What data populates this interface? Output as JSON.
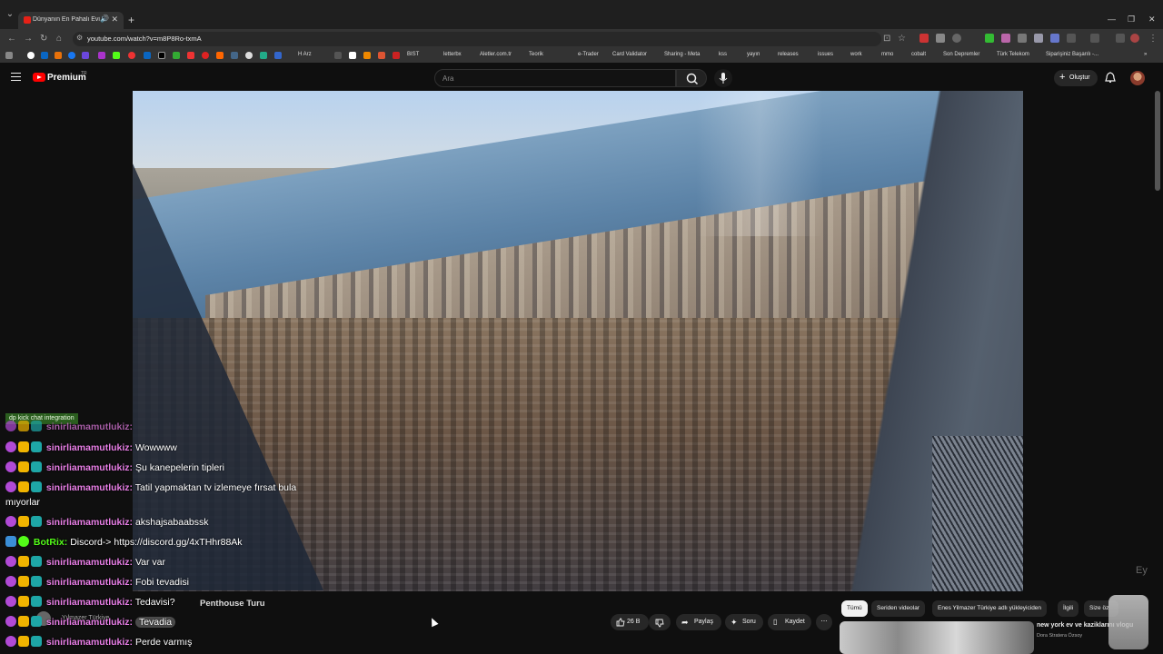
{
  "browser": {
    "tab_title": "Dünyanın En Pahalı Evi / N...",
    "url": "youtube.com/watch?v=m8P8Ro-txmA",
    "bookmarks": [
      "H Arz",
      "BIST",
      "letterbx",
      "Aletler.com.tr",
      "Teorik",
      "e-Trader",
      "Card Validator",
      "Sharing - Meta",
      "kss",
      "yayın",
      "releases",
      "issues",
      "work",
      "mmo",
      "cobalt",
      "Son Depremler",
      "Türk Telekom",
      "Siparişiniz Başarılı -..."
    ]
  },
  "masthead": {
    "logo_text": "Premium",
    "logo_sup": "TR",
    "search_placeholder": "Ara",
    "create_label": "Oluştur"
  },
  "chat": {
    "header": "dp kick chat integration",
    "messages": [
      {
        "user": "sinirliamamutlukiz:",
        "text": ""
      },
      {
        "user": "sinirliamamutlukiz:",
        "text": "Wowwww"
      },
      {
        "user": "sinirliamamutlukiz:",
        "text": "Şu kanepelerin tipleri"
      },
      {
        "user": "sinirliamamutlukiz:",
        "text": "Tatil yapmaktan tv izlemeye fırsat bula",
        "wrap": "mıyorlar"
      },
      {
        "user": "sinirliamamutlukiz:",
        "text": "akshajsabaabssk"
      },
      {
        "user": "BotRix:",
        "text": "Discord-> https://discord.gg/4xTHhr88Ak",
        "bot": true
      },
      {
        "user": "sinirliamamutlukiz:",
        "text": "Var var"
      },
      {
        "user": "sinirliamamutlukiz:",
        "text": "Fobi tevadisi"
      },
      {
        "user": "sinirliamamutlukiz:",
        "text": "Tedavisi?"
      },
      {
        "user": "sinirliamamutlukiz:",
        "text": "Tevadia"
      },
      {
        "user": "sinirliamamutlukiz:",
        "text": "Perde varmış"
      }
    ]
  },
  "video": {
    "title_fragment": "Penthouse Turu",
    "channel_fragment": "Yılmazer Türkiye"
  },
  "actions": {
    "likes": "26 B",
    "share": "Paylaş",
    "ask": "Soru",
    "save": "Kaydet"
  },
  "chips": [
    "Tümü",
    "Seriden videolar",
    "Enes Yilmazer Türkiye adlı yükleyiciden",
    "İlgili",
    "Size öz"
  ],
  "related": {
    "title": "new york ev ve kaziklarını vlogu",
    "channel": "Dora Stratera Özsoy"
  }
}
